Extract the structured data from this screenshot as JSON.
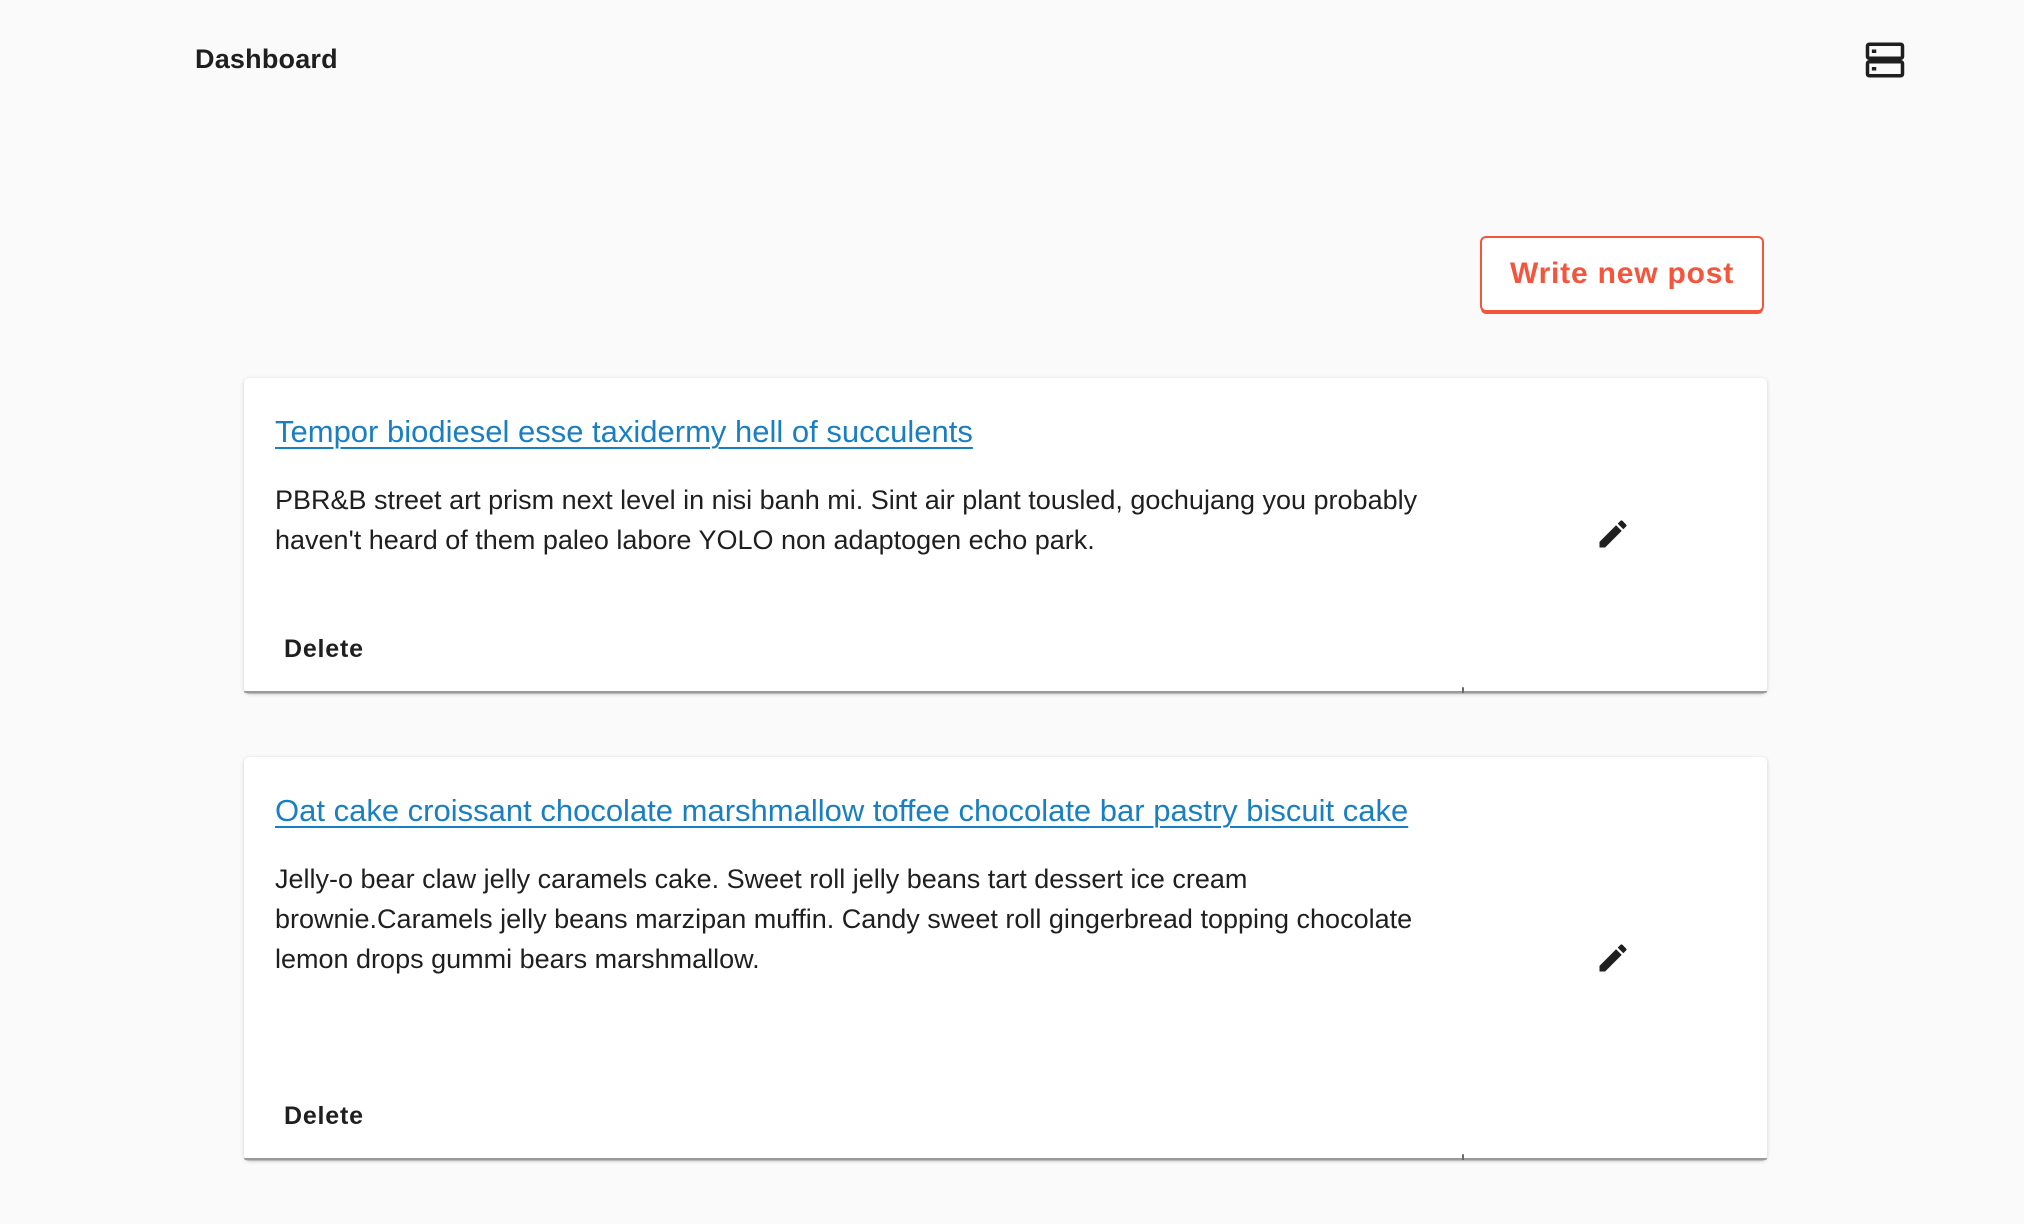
{
  "app_bar": {
    "title": "Dashboard",
    "menu_icon": "server-storage-icon"
  },
  "actions": {
    "write_label": "Write new post"
  },
  "colors": {
    "accent": "#f4553d",
    "link": "#1a7fc2",
    "text": "#1f1f1f",
    "background": "#fafafa"
  },
  "posts": [
    {
      "title": "Tempor biodiesel esse taxidermy hell of succulents",
      "excerpt": "PBR&B street art prism next level in nisi banh mi. Sint air plant tousled, gochujang you probably haven't heard of them paleo labore YOLO non adaptogen echo park.",
      "delete_label": "Delete",
      "edit_icon": "pencil-icon"
    },
    {
      "title": "Oat cake croissant chocolate marshmallow toffee chocolate bar pastry biscuit cake",
      "excerpt": "Jelly-o bear claw jelly caramels cake. Sweet roll jelly beans tart dessert ice cream brownie.Caramels jelly beans marzipan muffin. Candy sweet roll gingerbread topping chocolate lemon drops gummi bears marshmallow.",
      "delete_label": "Delete",
      "edit_icon": "pencil-icon"
    }
  ]
}
